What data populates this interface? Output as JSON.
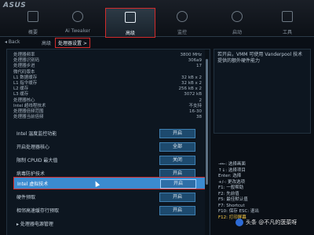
{
  "brand": "ASUS",
  "tabs": [
    {
      "label": "概要"
    },
    {
      "label": "Ai Tweaker"
    },
    {
      "label": "高级"
    },
    {
      "label": "监控"
    },
    {
      "label": "启动"
    },
    {
      "label": "工具"
    }
  ],
  "breadcrumb": {
    "back": "Back",
    "level1": "高级",
    "level2": "处理器设置 >"
  },
  "info_rows": [
    {
      "label": "处理器频率",
      "value": "3800 MHz"
    },
    {
      "label": "处理器识别码",
      "value": "306a9"
    },
    {
      "label": "处理器步进",
      "value": "17"
    },
    {
      "label": "微代码版本",
      "value": ""
    },
    {
      "label": "L1 数据缓存",
      "value": "32 kB x 2"
    },
    {
      "label": "L1 指令缓存",
      "value": "32 kB x 2"
    },
    {
      "label": "L2 缓存",
      "value": "256 kB x 2"
    },
    {
      "label": "L3 缓存",
      "value": "3072 kB"
    },
    {
      "label": "处理器核心",
      "value": "2"
    },
    {
      "label": "Intel 超线程技术",
      "value": "不支持"
    },
    {
      "label": "处理器倍频范围",
      "value": "16-30"
    },
    {
      "label": "处理器当前倍频",
      "value": "38"
    }
  ],
  "options": [
    {
      "label": "Intel 温度监控功能",
      "value": "开启"
    },
    {
      "label": "开启处理器核心",
      "value": "全部"
    },
    {
      "label": "限制 CPUID 最大值",
      "value": "关闭"
    },
    {
      "label": "病毒防护技术",
      "value": "开启"
    },
    {
      "label": "Intel 虚拟技术",
      "value": "开启"
    },
    {
      "label": "硬件预取",
      "value": "开启"
    },
    {
      "label": "相邻高速缓存行预取",
      "value": "开启"
    },
    {
      "label": "处理器电源管理",
      "value": ""
    }
  ],
  "help_text": "若开启，VMM 可使用 Vanderpool 技术提供的额外硬件能力",
  "keys": [
    "→←: 选择画面",
    "↑↓: 选择项目",
    "Enter: 选择",
    "+/-: 更改选项",
    "F1: 一般帮助",
    "F2: 先前值",
    "F5: 最佳默认值",
    "F7: Shortcut",
    "F10: 保存  ESC: 退出",
    "F12: 打印屏幕"
  ],
  "watermark": "头条 @不凡的菠菜呀",
  "colors": {
    "accent_red": "#d22b2b",
    "selected_row": "#3b8bd0",
    "value_box": "#1d4a6e"
  }
}
